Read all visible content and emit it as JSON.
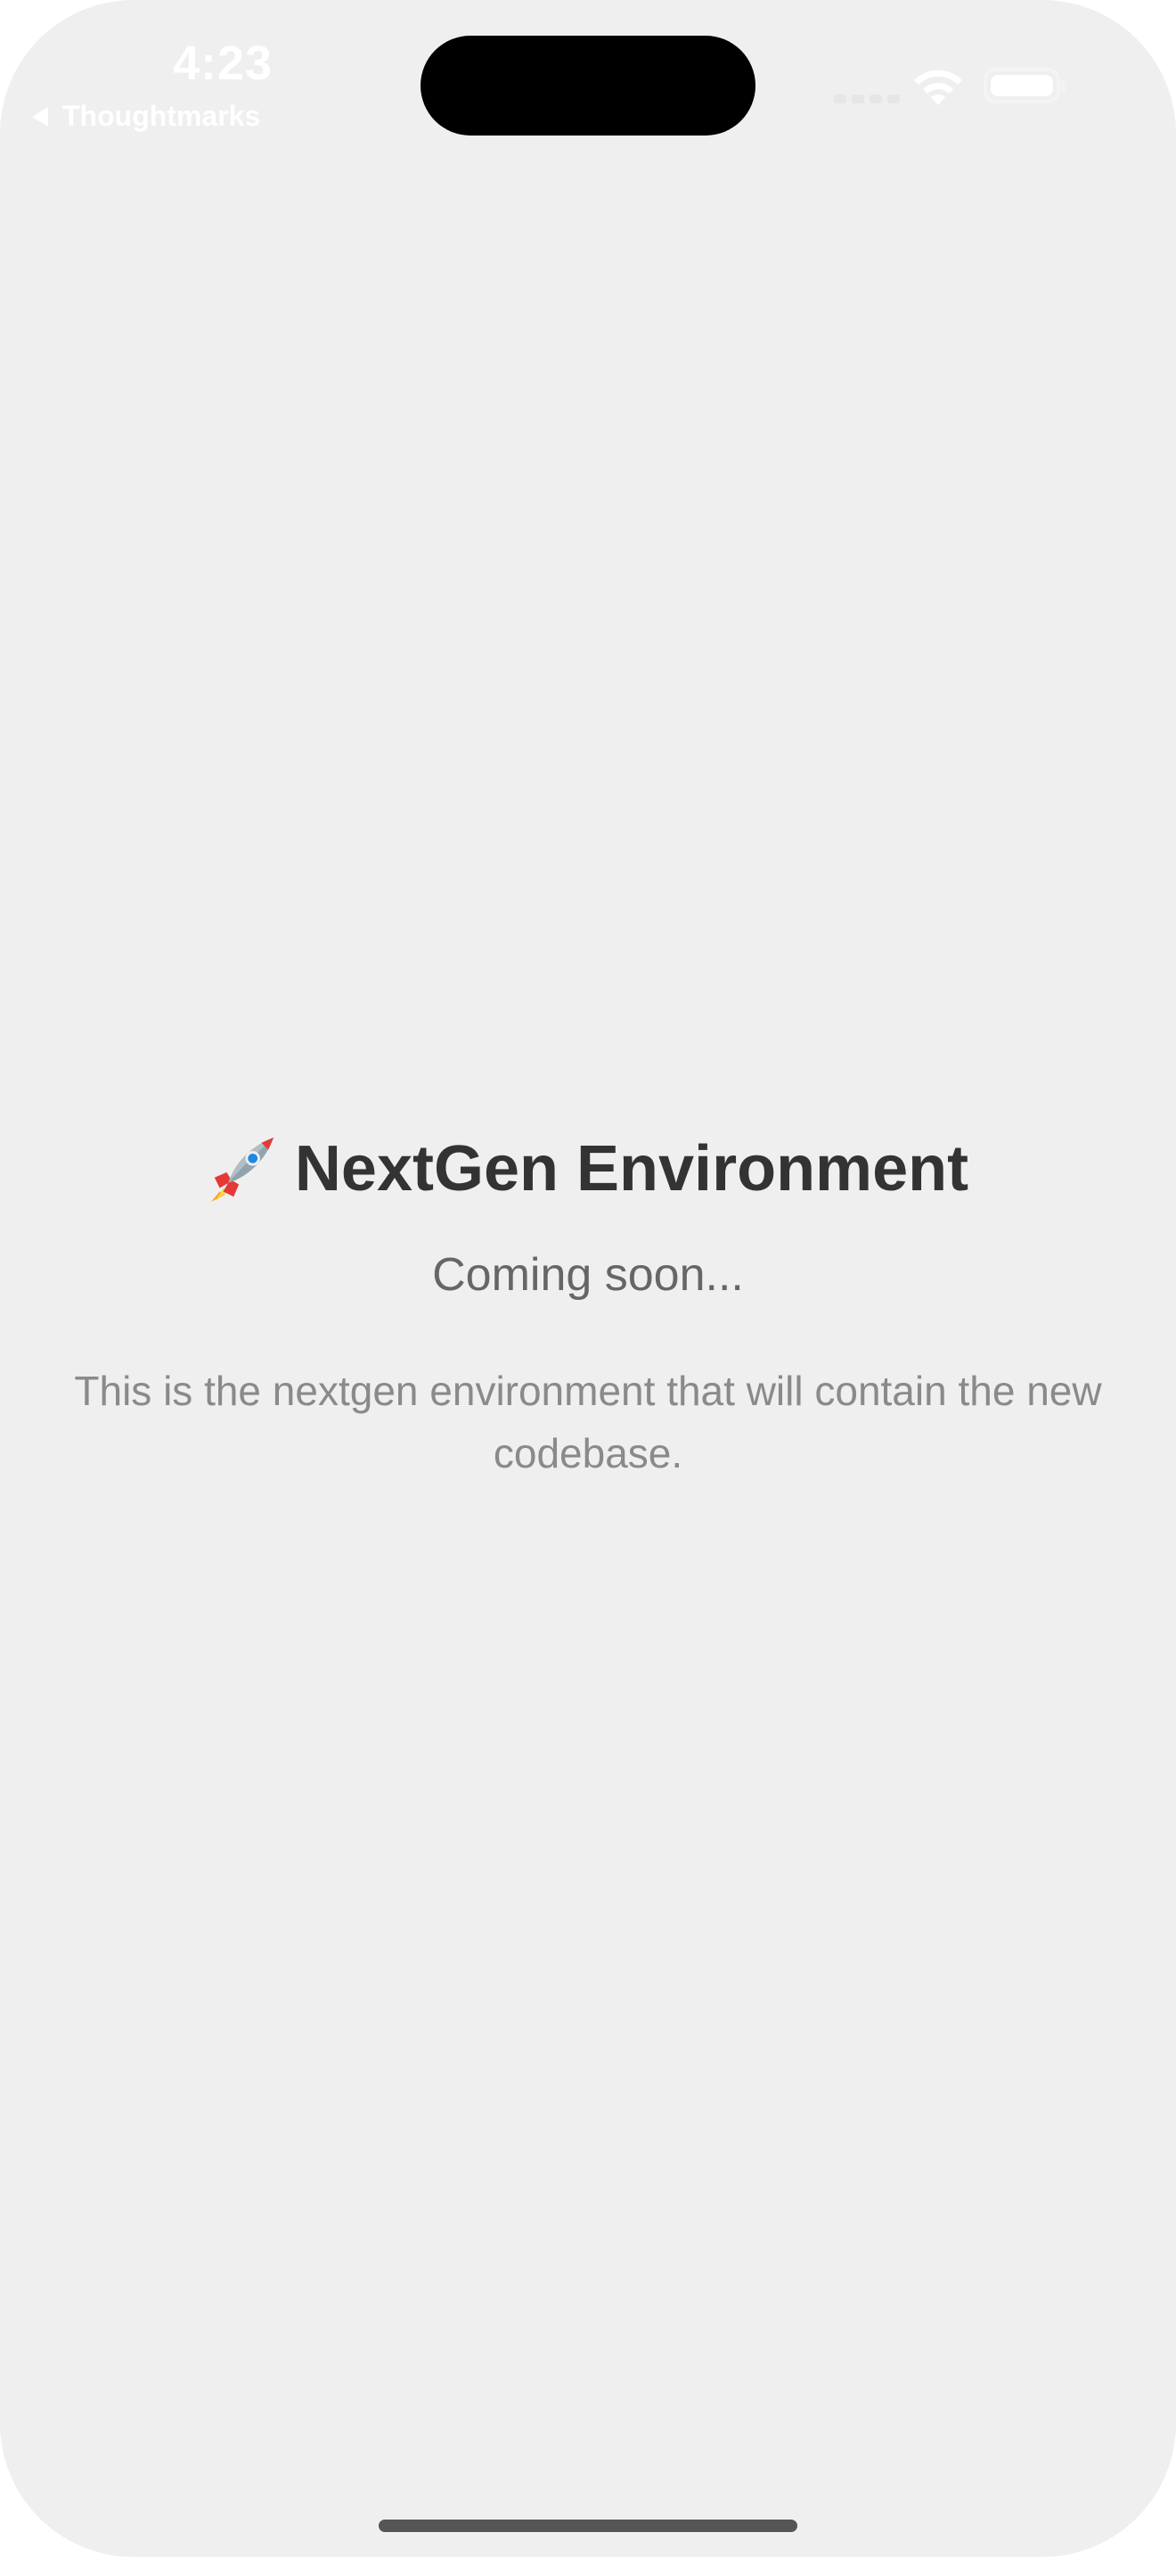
{
  "status_bar": {
    "time": "4:23",
    "back_app_label": "Thoughtmarks"
  },
  "main": {
    "title_icon": "rocket-icon",
    "title": "NextGen Environment",
    "subtitle": "Coming soon...",
    "description": "This is the nextgen environment that will contain the new codebase."
  },
  "colors": {
    "background": "#efefef",
    "title": "#333333",
    "subtitle": "#666666",
    "description": "#8a8a8a"
  }
}
